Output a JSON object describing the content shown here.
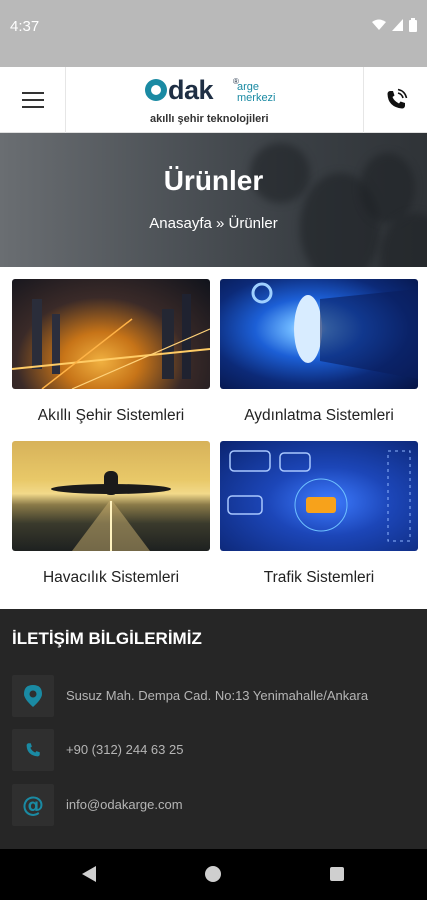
{
  "status_bar": {
    "time": "4:37",
    "icons": [
      "wifi-icon",
      "signal-icon",
      "battery-icon"
    ]
  },
  "header": {
    "logo": {
      "brand": "odak",
      "registered": "®",
      "line1": "arge",
      "line2": "merkezi",
      "tagline": "akıllı şehir teknolojileri"
    },
    "icons": [
      "menu-icon",
      "phone-icon"
    ]
  },
  "hero": {
    "title": "Ürünler",
    "breadcrumb": "Anasayfa » Ürünler"
  },
  "products": [
    {
      "title": "Akıllı Şehir Sistemleri",
      "image": "city-night-aerial"
    },
    {
      "title": "Aydınlatma Sistemleri",
      "image": "blue-led-lamp"
    },
    {
      "title": "Havacılık Sistemleri",
      "image": "airplane-runway"
    },
    {
      "title": "Trafik Sistemleri",
      "image": "traffic-cars-sensors"
    }
  ],
  "contact": {
    "title": "İLETİŞİM BİLGİLERİMİZ",
    "address": "Susuz Mah. Dempa Cad. No:13 Yenimahalle/Ankara",
    "phone": "+90 (312) 244 63 25",
    "email": "info@odakarge.com"
  },
  "colors": {
    "accent": "#1a8aa3",
    "dark_section": "#262626",
    "status_bar": "#b9b9b9"
  }
}
